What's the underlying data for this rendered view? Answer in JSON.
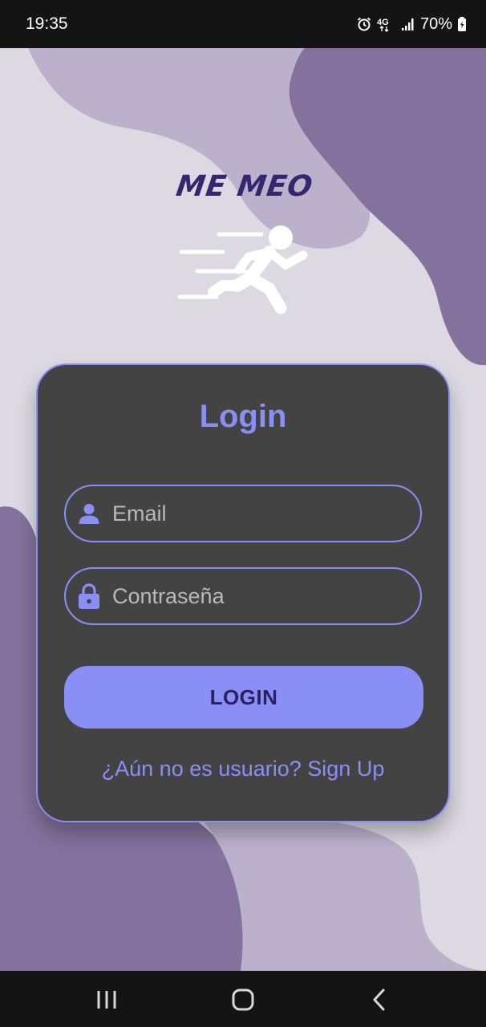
{
  "status_bar": {
    "time": "19:35",
    "network": "4G",
    "battery": "70%",
    "icons": [
      "alarm-icon",
      "network-4g-icon",
      "signal-icon",
      "battery-charging-icon"
    ]
  },
  "logo": {
    "text": "ME MEO",
    "icon": "running-person-icon"
  },
  "login_card": {
    "title": "Login",
    "email": {
      "placeholder": "Email",
      "value": "",
      "icon": "user-icon"
    },
    "password": {
      "placeholder": "Contraseña",
      "value": "",
      "icon": "lock-icon"
    },
    "login_button": "LOGIN",
    "signup_prompt": "¿Aún no es usuario? Sign Up"
  },
  "nav_bar": {
    "buttons": [
      "recent-apps-icon",
      "home-icon",
      "back-icon"
    ]
  },
  "colors": {
    "accent": "#8a8ff5",
    "card_bg": "#434343",
    "background": "#dcd9e2",
    "blob_dark": "#83729d",
    "blob_light": "#bbb1cb",
    "logo_text": "#352670",
    "button_text": "#2c2060"
  }
}
